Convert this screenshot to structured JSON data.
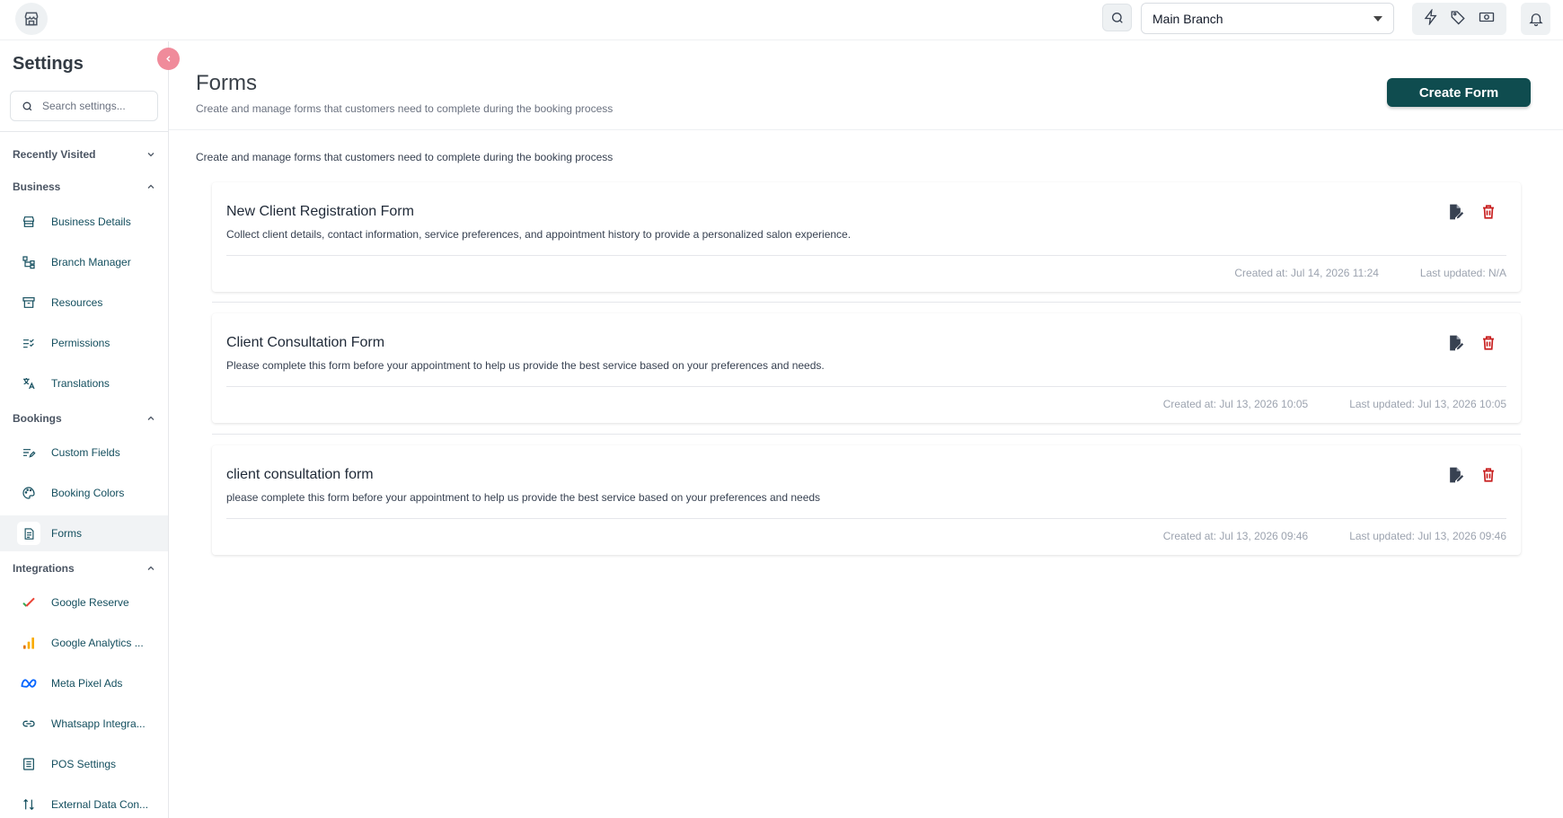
{
  "topbar": {
    "branch_selected": "Main Branch",
    "icons": [
      "store-icon",
      "search-icon",
      "lightning-icon",
      "tag-icon",
      "cash-icon",
      "bell-icon"
    ]
  },
  "sidebar": {
    "title": "Settings",
    "search_placeholder": "Search settings...",
    "sections": {
      "recent": "Recently Visited",
      "business": "Business",
      "bookings": "Bookings",
      "integrations": "Integrations"
    },
    "items": [
      {
        "label": "Business Details",
        "icon": "storefront-icon"
      },
      {
        "label": "Branch Manager",
        "icon": "branch-tree-icon"
      },
      {
        "label": "Resources",
        "icon": "archive-box-icon"
      },
      {
        "label": "Permissions",
        "icon": "checklist-icon"
      },
      {
        "label": "Translations",
        "icon": "translate-icon"
      },
      {
        "label": "Custom Fields",
        "icon": "edit-list-icon"
      },
      {
        "label": "Booking Colors",
        "icon": "palette-icon"
      },
      {
        "label": "Forms",
        "icon": "document-icon"
      },
      {
        "label": "Google Reserve",
        "icon": "google-check-icon"
      },
      {
        "label": "Google Analytics ...",
        "icon": "analytics-bars-icon"
      },
      {
        "label": "Meta Pixel Ads",
        "icon": "meta-infinity-icon"
      },
      {
        "label": "Whatsapp Integra...",
        "icon": "link-icon"
      },
      {
        "label": "POS Settings",
        "icon": "receipt-icon"
      },
      {
        "label": "External Data Con...",
        "icon": "data-flow-icon"
      }
    ],
    "active_item": "Forms"
  },
  "main": {
    "title": "Forms",
    "subtitle": "Create and manage forms that customers need to complete during the booking process",
    "create_label": "Create Form",
    "description": "Create and manage forms that customers need to complete during the booking process",
    "forms": [
      {
        "title": "New Client Registration Form",
        "description": "Collect client details, contact information, service preferences, and appointment history to provide a personalized salon experience.",
        "created": "Created at: Jul 14, 2026 11:24",
        "updated": "Last updated: N/A"
      },
      {
        "title": "Client Consultation Form",
        "description": "Please complete this form before your appointment to help us provide the best service based on your preferences and needs.",
        "created": "Created at: Jul 13, 2026 10:05",
        "updated": "Last updated: Jul 13, 2026 10:05"
      },
      {
        "title": "client consultation form",
        "description": "please complete this form before your appointment to help us provide the best service based on your preferences and needs",
        "created": "Created at: Jul 13, 2026 09:46",
        "updated": "Last updated: Jul 13, 2026 09:46"
      }
    ]
  },
  "colors": {
    "accent": "#0f4c4f",
    "nav_text": "#134e5e",
    "delete": "#c81e1e",
    "collapse": "#f08b9b"
  }
}
